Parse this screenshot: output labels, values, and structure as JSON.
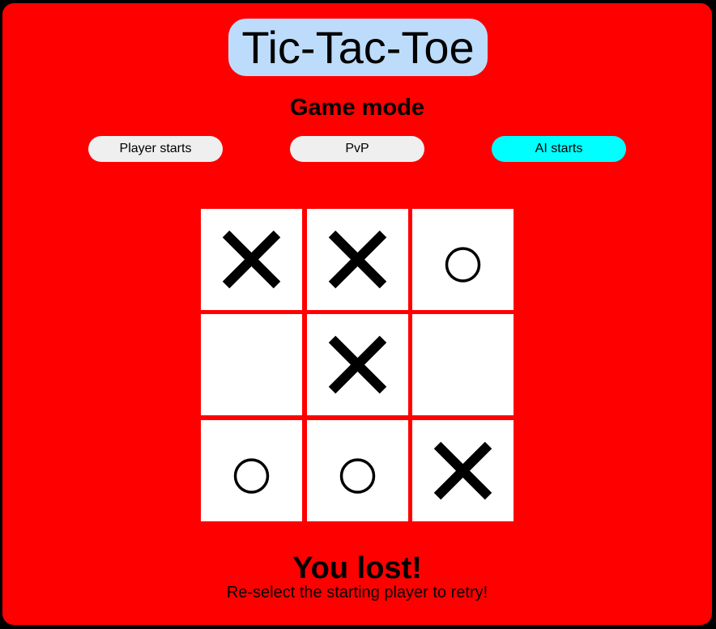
{
  "title": "Tic-Tac-Toe",
  "mode_heading": "Game mode",
  "mode_buttons": [
    {
      "label": "Player starts",
      "active": false
    },
    {
      "label": "PvP",
      "active": false
    },
    {
      "label": "AI starts",
      "active": true
    }
  ],
  "board": [
    "X",
    "X",
    "O",
    "",
    "X",
    "",
    "O",
    "O",
    "X"
  ],
  "result": "You lost!",
  "hint": "Re-select the starting player to retry!",
  "colors": {
    "background": "#ff0000",
    "title_bg": "#bddcfb",
    "button_bg": "#efefef",
    "button_active_bg": "#00ffff",
    "cell_bg": "#ffffff"
  }
}
